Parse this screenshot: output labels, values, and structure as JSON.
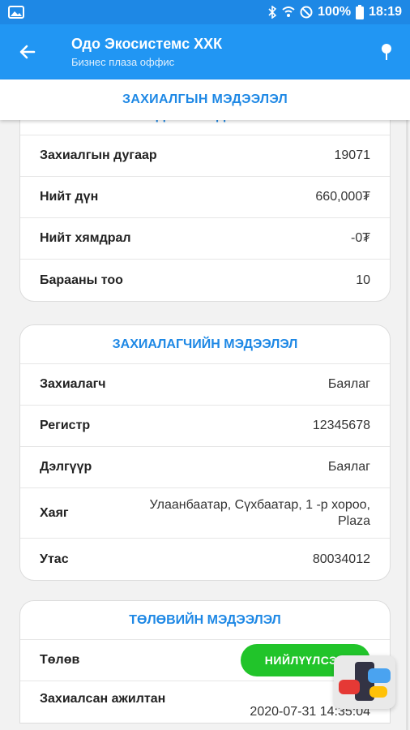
{
  "status_bar": {
    "battery_percent": "100%",
    "time": "18:19",
    "icons": [
      "image-icon",
      "bluetooth-icon",
      "wifi-icon",
      "no-disturb-icon",
      "battery-icon"
    ]
  },
  "header": {
    "title": "Одо Экосистемс ХХК",
    "subtitle": "Бизнес плаза оффис",
    "icons": [
      "back-arrow-icon",
      "location-pin-icon"
    ]
  },
  "section_header": "ЗАХИАЛГЫН МЭДЭЭЛЭЛ",
  "order_card": {
    "title": "ҮНДСЭН МЭДЭЭЛЭЛ",
    "rows": [
      {
        "label": "Захиалгын дугаар",
        "value": "19071"
      },
      {
        "label": "Нийт дүн",
        "value": "660,000₮"
      },
      {
        "label": "Нийт хямдрал",
        "value": "-0₮"
      },
      {
        "label": "Барааны тоо",
        "value": "10"
      }
    ]
  },
  "customer_card": {
    "title": "ЗАХИАЛАГЧИЙН МЭДЭЭЛЭЛ",
    "rows": [
      {
        "label": "Захиалагч",
        "value": "Баялаг"
      },
      {
        "label": "Регистр",
        "value": "12345678"
      },
      {
        "label": "Дэлгүүр",
        "value": "Баялаг"
      },
      {
        "label": "Хаяг",
        "value": "Улаанбаатар, Сүхбаатар, 1 -р хороо, Plaza"
      },
      {
        "label": "Утас",
        "value": "80034012"
      }
    ]
  },
  "payment_card": {
    "title": "ТӨЛӨВИЙН МЭДЭЭЛЭЛ",
    "status_label": "Төлөв",
    "status_value": "НИЙЛҮҮЛСЭН",
    "employee_label": "Захиалсан ажилтан",
    "date_value": "2020-07-31 14:35:04"
  },
  "colors": {
    "primary": "#2196f3",
    "status_bar": "#1e88e5",
    "accent_text": "#1e88e5",
    "success": "#21c42a"
  }
}
